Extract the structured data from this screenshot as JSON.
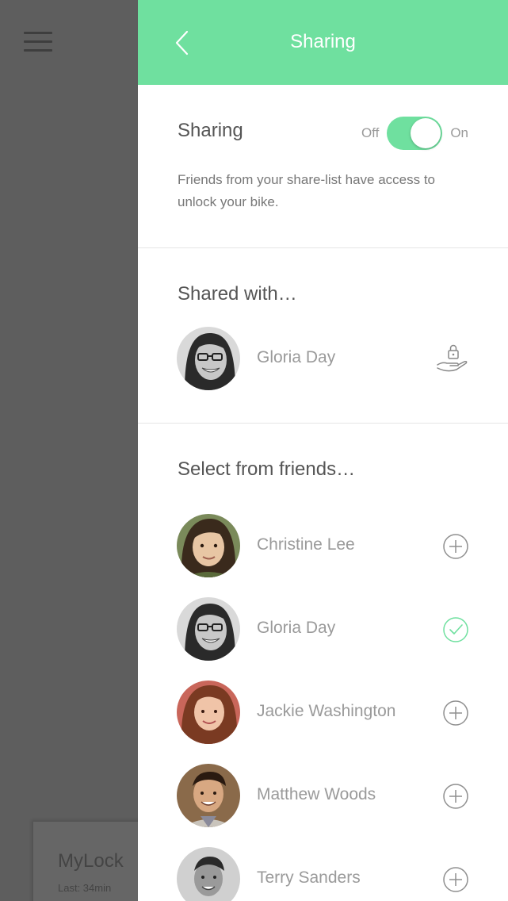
{
  "background": {
    "lock_name": "MyLock",
    "lock_last": "Last: 34min"
  },
  "header": {
    "title": "Sharing"
  },
  "sharing": {
    "title": "Sharing",
    "toggle_off": "Off",
    "toggle_on": "On",
    "enabled": true,
    "description": "Friends from your share-list have access to unlock your bike."
  },
  "shared_with": {
    "title": "Shared with…",
    "people": [
      {
        "name": "Gloria Day",
        "icon": "hand-lock-icon"
      }
    ]
  },
  "friends": {
    "title": "Select from friends…",
    "people": [
      {
        "name": "Christine Lee",
        "status": "add"
      },
      {
        "name": "Gloria Day",
        "status": "selected"
      },
      {
        "name": "Jackie Washington",
        "status": "add"
      },
      {
        "name": "Matthew Woods",
        "status": "add"
      },
      {
        "name": "Terry Sanders",
        "status": "add"
      }
    ]
  },
  "colors": {
    "accent": "#6fe09f",
    "overlay": "#5e5e5e"
  }
}
